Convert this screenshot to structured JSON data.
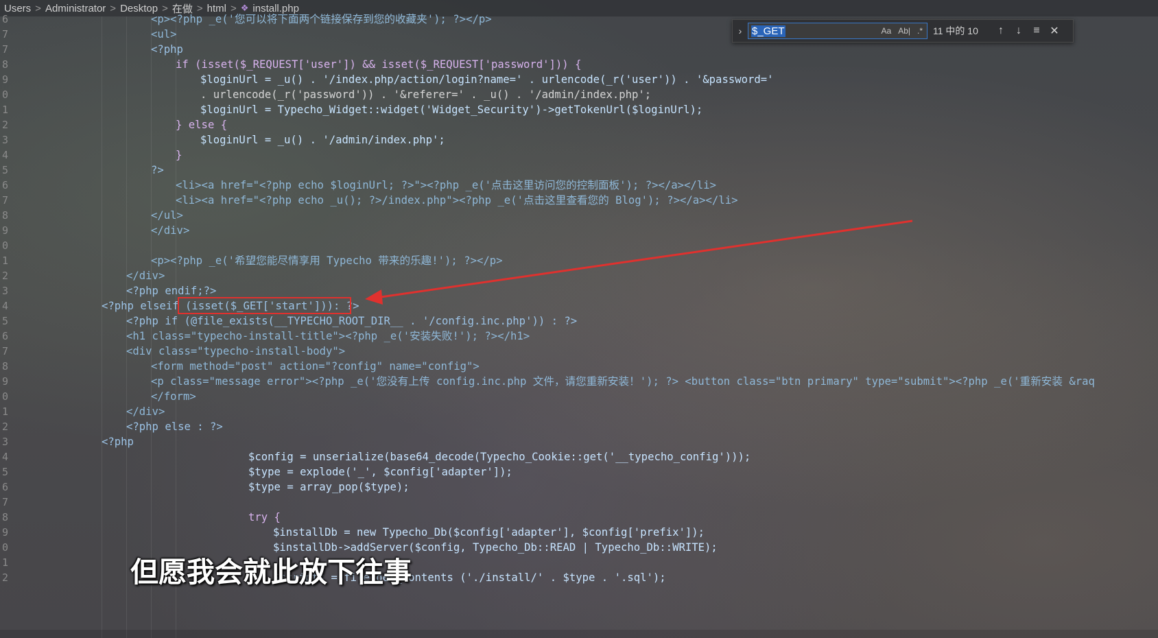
{
  "breadcrumb": {
    "items": [
      "Users",
      "Administrator",
      "Desktop",
      "在做",
      "html"
    ],
    "file": "install.php",
    "separator": ">"
  },
  "find_widget": {
    "query": "$_GET",
    "match_case_label": "Aa",
    "whole_word_label": "Ab|",
    "regex_label": ".*",
    "count": "11 中的 10",
    "prev_icon": "arrow-up-icon",
    "next_icon": "arrow-down-icon",
    "selection_icon": "find-in-selection-icon",
    "close_icon": "close-icon"
  },
  "gutter": {
    "numbers": [
      "6",
      "7",
      "7",
      "8",
      "9",
      "0",
      "1",
      "2",
      "3",
      "4",
      "5",
      "6",
      "7",
      "8",
      "9",
      "0",
      "1",
      "2",
      "3",
      "4",
      "5",
      "6",
      "7",
      "8",
      "9",
      "0",
      "1",
      "2",
      "3",
      "4",
      "5",
      "6",
      "7",
      "8",
      "9",
      "0",
      "1",
      "2"
    ]
  },
  "code_lines": [
    "<p><?php _e('您可以将下面两个链接保存到您的收藏夹'); ?></p>",
    "<ul>",
    "<?php",
    "if (isset($_REQUEST['user']) && isset($_REQUEST['password'])) {",
    "$loginUrl = _u() . '/index.php/action/login?name=' . urlencode(_r('user')) . '&password='",
    ". urlencode(_r('password')) . '&referer=' . _u() . '/admin/index.php';",
    "$loginUrl = Typecho_Widget::widget('Widget_Security')->getTokenUrl($loginUrl);",
    "} else {",
    "$loginUrl = _u() . '/admin/index.php';",
    "}",
    "?>",
    "<li><a href=\"<?php echo $loginUrl; ?>\"><?php _e('点击这里访问您的控制面板'); ?></a></li>",
    "<li><a href=\"<?php echo _u(); ?>/index.php\"><?php _e('点击这里查看您的 Blog'); ?></a></li>",
    "</ul>",
    "</div>",
    "",
    "<p><?php _e('希望您能尽情享用 Typecho 带来的乐趣!'); ?></p>",
    "</div>",
    "<?php endif;?>",
    "<?php elseif (isset($_GET['start'])): ?>",
    "<?php if (@file_exists(__TYPECHO_ROOT_DIR__ . '/config.inc.php')) : ?>",
    "<h1 class=\"typecho-install-title\"><?php _e('安装失败!'); ?></h1>",
    "<div class=\"typecho-install-body\">",
    "<form method=\"post\" action=\"?config\" name=\"config\">",
    "<p class=\"message error\"><?php _e('您没有上传 config.inc.php 文件，请您重新安装！'); ?> <button class=\"btn primary\" type=\"submit\"><?php _e('重新安装 &raq",
    "</form>",
    "</div>",
    "<?php else : ?>",
    "<?php",
    "$config = unserialize(base64_decode(Typecho_Cookie::get('__typecho_config')));",
    "$type = explode('_', $config['adapter']);",
    "$type = array_pop($type);",
    "",
    "try {",
    "$installDb = new Typecho_Db($config['adapter'], $config['prefix']);",
    "$installDb->addServer($config, Typecho_Db::READ | Typecho_Db::WRITE);",
    "",
    "$scripts = file_get_contents ('./install/' . $type . '.sql');"
  ],
  "subtitle": "但愿我会就此放下往事",
  "colors": {
    "highlight_box": "#e0312e",
    "arrow": "#e0312e",
    "find_border": "#3a78c8"
  }
}
